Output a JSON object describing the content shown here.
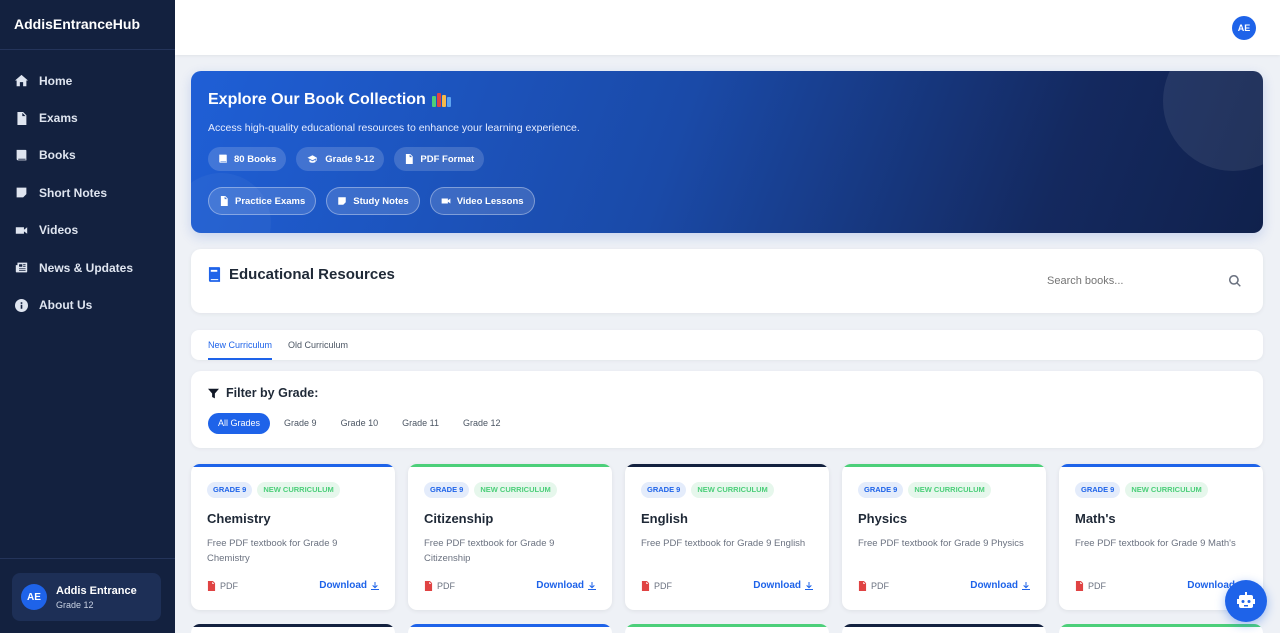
{
  "brand": "AddisEntranceHub",
  "nav": [
    {
      "label": "Home",
      "icon": "home-icon"
    },
    {
      "label": "Exams",
      "icon": "document-icon"
    },
    {
      "label": "Books",
      "icon": "book-icon"
    },
    {
      "label": "Short Notes",
      "icon": "note-icon"
    },
    {
      "label": "Videos",
      "icon": "video-icon"
    },
    {
      "label": "News & Updates",
      "icon": "newspaper-icon"
    },
    {
      "label": "About Us",
      "icon": "info-icon"
    }
  ],
  "user": {
    "initials": "AE",
    "name": "Addis Entrance",
    "grade": "Grade 12"
  },
  "topbar": {
    "avatar": "AE"
  },
  "hero": {
    "title": "Explore Our Book Collection",
    "subtitle": "Access high-quality educational resources to enhance your learning experience.",
    "stats": [
      "80 Books",
      "Grade 9-12",
      "PDF Format"
    ],
    "links": [
      "Practice Exams",
      "Study Notes",
      "Video Lessons"
    ]
  },
  "resources": {
    "title": "Educational Resources",
    "search_placeholder": "Search books..."
  },
  "tabs": [
    "New Curriculum",
    "Old Curriculum"
  ],
  "filter": {
    "title": "Filter by Grade:",
    "grades": [
      "All Grades",
      "Grade 9",
      "Grade 10",
      "Grade 11",
      "Grade 12"
    ]
  },
  "books": [
    {
      "grade": "GRADE 9",
      "curriculum": "NEW CURRICULUM",
      "title": "Chemistry",
      "desc": "Free PDF textbook for Grade 9 Chemistry",
      "format": "PDF",
      "action": "Download",
      "accent": "#1e63e9"
    },
    {
      "grade": "GRADE 9",
      "curriculum": "NEW CURRICULUM",
      "title": "Citizenship",
      "desc": "Free PDF textbook for Grade 9 Citizenship",
      "format": "PDF",
      "action": "Download",
      "accent": "#4ccf7a"
    },
    {
      "grade": "GRADE 9",
      "curriculum": "NEW CURRICULUM",
      "title": "English",
      "desc": "Free PDF textbook for Grade 9 English",
      "format": "PDF",
      "action": "Download",
      "accent": "#13213f"
    },
    {
      "grade": "GRADE 9",
      "curriculum": "NEW CURRICULUM",
      "title": "Physics",
      "desc": "Free PDF textbook for Grade 9 Physics",
      "format": "PDF",
      "action": "Download",
      "accent": "#4ccf7a"
    },
    {
      "grade": "GRADE 9",
      "curriculum": "NEW CURRICULUM",
      "title": "Math's",
      "desc": "Free PDF textbook for Grade 9 Math's",
      "format": "PDF",
      "action": "Download",
      "accent": "#1e63e9"
    }
  ],
  "next_row_accents": [
    "#13213f",
    "#1e63e9",
    "#4ccf7a",
    "#13213f",
    "#4ccf7a"
  ]
}
